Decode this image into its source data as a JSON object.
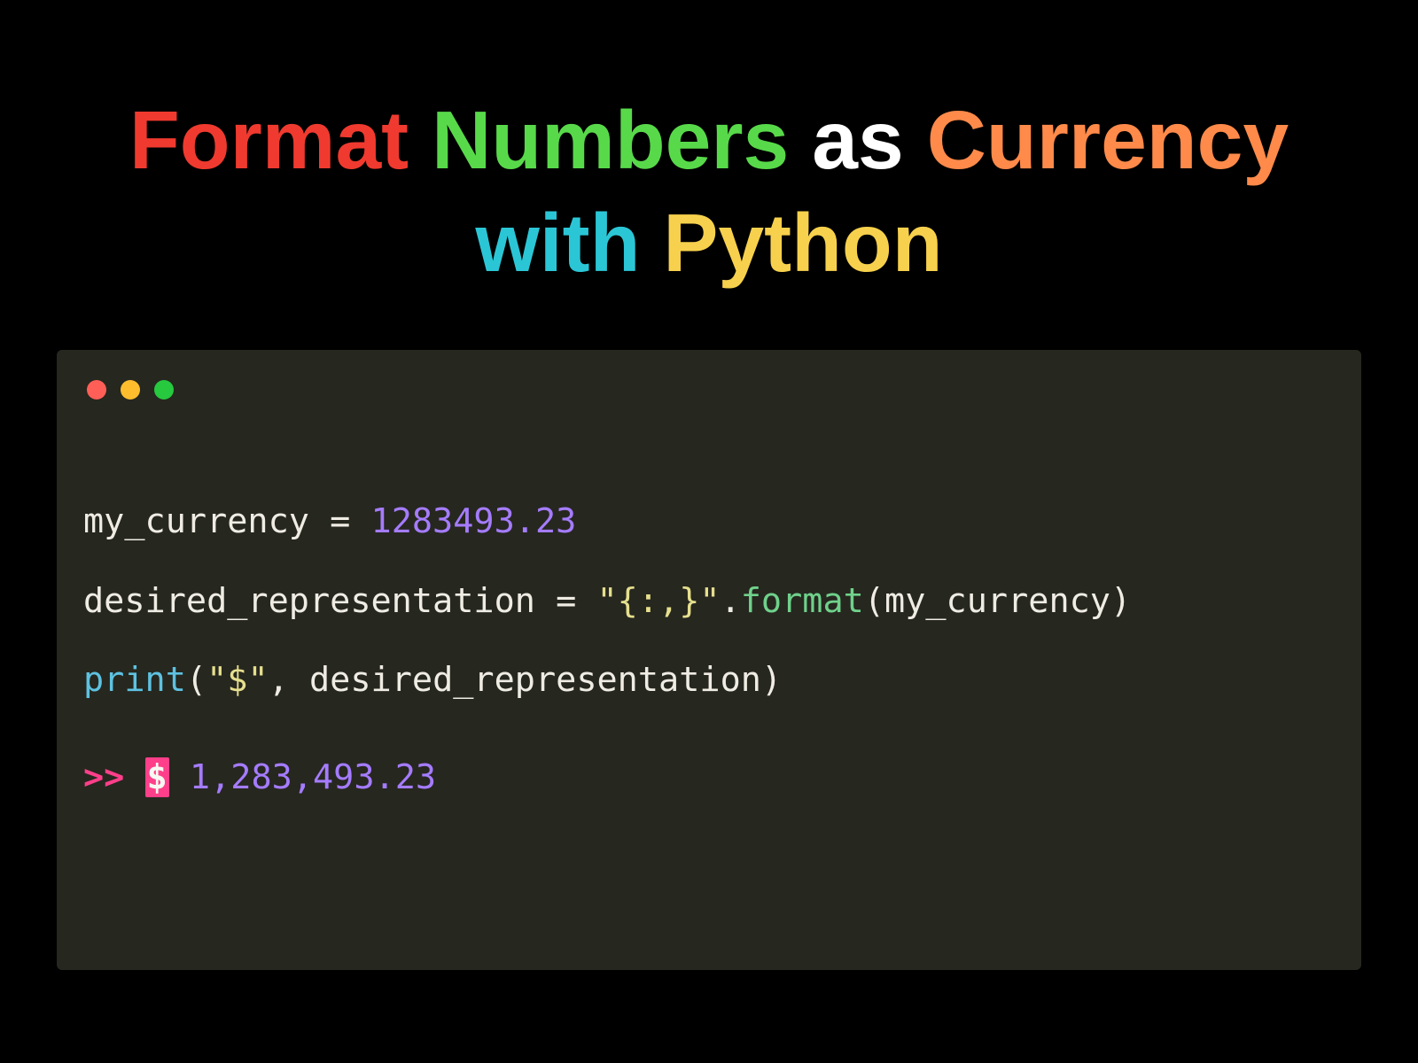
{
  "title": {
    "line1": {
      "w1": "Format",
      "w2": "Numbers",
      "w3": "as",
      "w4": "Currency"
    },
    "line2": {
      "w1": "with",
      "w2": "Python"
    }
  },
  "editor": {
    "dot_names": [
      "close",
      "minimize",
      "zoom"
    ]
  },
  "code": {
    "line1": {
      "a": "my_currency = ",
      "num": "1283493.23"
    },
    "line2": {
      "a": "desired_representation = ",
      "str": "\"{:,}\"",
      "dot": ".",
      "method": "format",
      "paren_open": "(",
      "arg": "my_currency",
      "paren_close": ")"
    },
    "line3": {
      "builtin": "print",
      "paren_open": "(",
      "str": "\"$\"",
      "comma": ", ",
      "arg": "desired_representation",
      "paren_close": ")"
    },
    "output": {
      "prompt": ">> ",
      "dollar": "$",
      "space": " ",
      "value": "1,283,493.23"
    }
  }
}
